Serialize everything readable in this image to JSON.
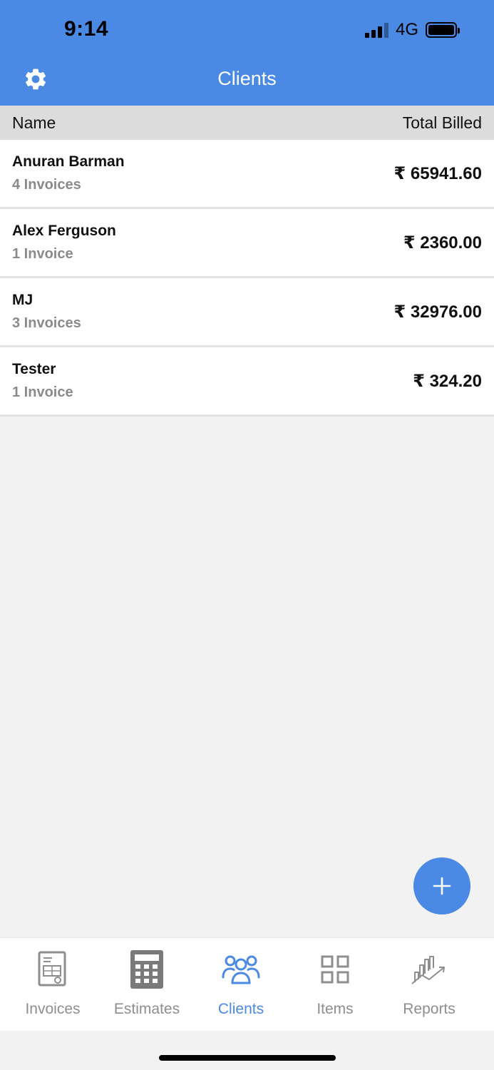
{
  "status_bar": {
    "time": "9:14",
    "network": "4G"
  },
  "header": {
    "title": "Clients",
    "settings_icon": "gear-icon"
  },
  "table_header": {
    "name_label": "Name",
    "total_label": "Total Billed"
  },
  "clients": [
    {
      "name": "Anuran Barman",
      "invoices": "4 Invoices",
      "total": "₹ 65941.60"
    },
    {
      "name": "Alex Ferguson",
      "invoices": "1 Invoice",
      "total": "₹ 2360.00"
    },
    {
      "name": "MJ",
      "invoices": "3 Invoices",
      "total": "₹ 32976.00"
    },
    {
      "name": "Tester",
      "invoices": "1 Invoice",
      "total": "₹ 324.20"
    }
  ],
  "fab": {
    "icon": "plus-icon"
  },
  "tabs": [
    {
      "label": "Invoices",
      "icon": "invoice-icon",
      "active": false
    },
    {
      "label": "Estimates",
      "icon": "calculator-icon",
      "active": false
    },
    {
      "label": "Clients",
      "icon": "clients-icon",
      "active": true
    },
    {
      "label": "Items",
      "icon": "grid-icon",
      "active": false
    },
    {
      "label": "Reports",
      "icon": "chart-icon",
      "active": false
    }
  ],
  "colors": {
    "accent": "#4a89e4",
    "header_bg": "#4a89e4",
    "inactive_tab": "#8e8e8e"
  }
}
